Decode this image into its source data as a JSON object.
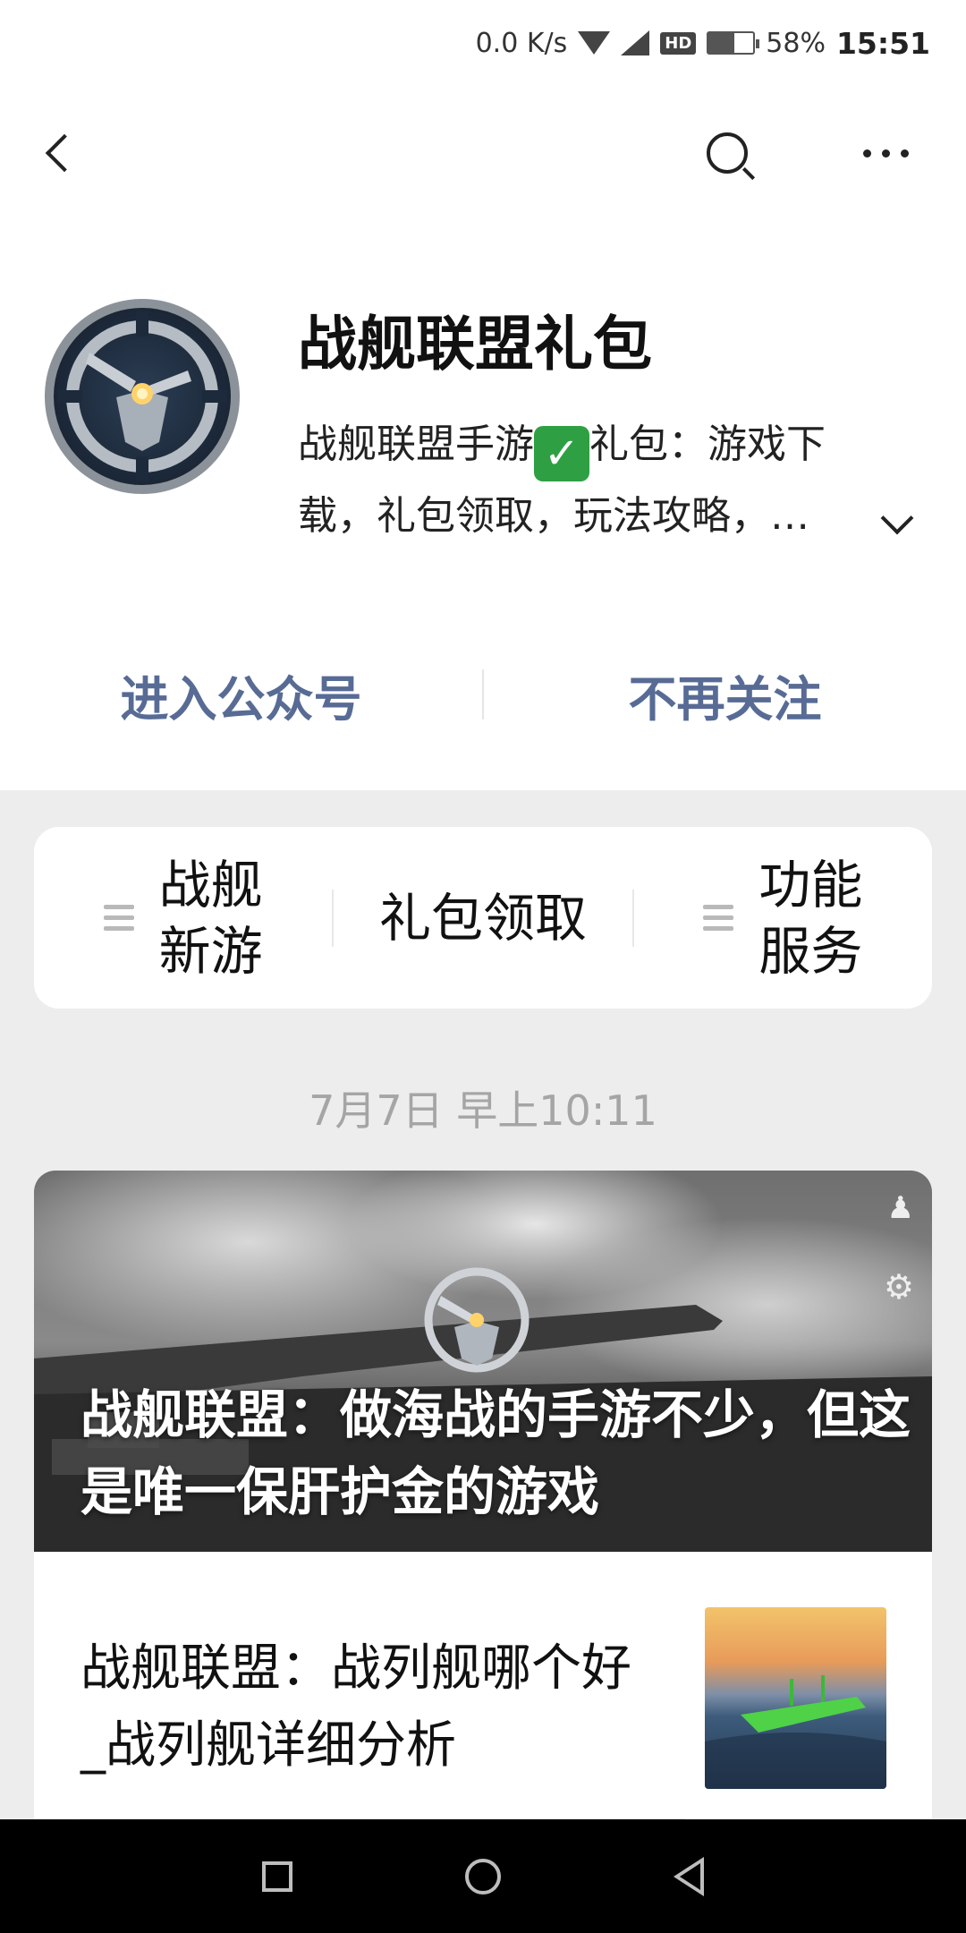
{
  "status_bar": {
    "net_speed": "0.0 K/s",
    "battery": "58%",
    "time": "15:51",
    "icons": [
      "wifi-icon",
      "signal-icon",
      "hd-icon",
      "battery-icon"
    ],
    "hd_label": "HD"
  },
  "nav": {
    "icons": [
      "back-icon",
      "search-icon",
      "more-icon"
    ]
  },
  "profile": {
    "name": "战舰联盟礼包",
    "description_part1": "战舰联盟手游",
    "description_part2": "礼包：游戏下载，礼包领取，玩法攻略，…",
    "check_symbol": "✓",
    "enter_label": "进入公众号",
    "unfollow_label": "不再关注"
  },
  "menu": {
    "items": [
      {
        "label_line1": "战舰",
        "label_line2": "新游",
        "has_submenu": true
      },
      {
        "label": "礼包领取",
        "has_submenu": false
      },
      {
        "label_line1": "功能",
        "label_line2": "服务",
        "has_submenu": true
      }
    ]
  },
  "timestamp": "7月7日 早上10:11",
  "article": {
    "hero_title": "战舰联盟：做海战的手游不少，但这是唯一保肝护金的游戏",
    "hero_icons": [
      "user-icon",
      "gear-icon"
    ],
    "items": [
      {
        "title": "战舰联盟：战列舰哪个好_战列舰详细分析"
      }
    ]
  },
  "system_nav": {
    "icons": [
      "recent-apps-icon",
      "home-icon",
      "back-nav-icon"
    ]
  },
  "colors": {
    "link": "#576b95",
    "page_bg": "#ededed",
    "check_green": "#2ea043"
  }
}
